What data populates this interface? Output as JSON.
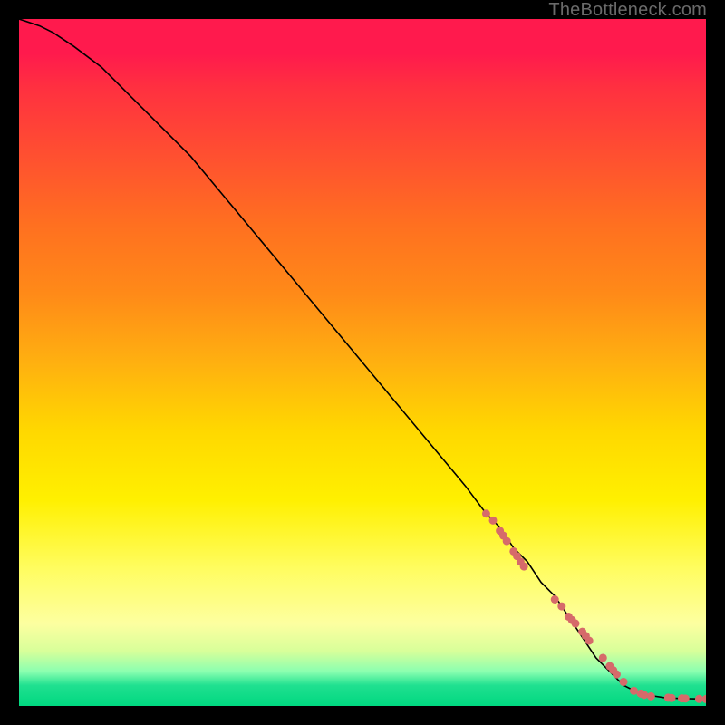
{
  "watermark": "TheBottleneck.com",
  "chart_data": {
    "type": "line",
    "title": "",
    "xlabel": "",
    "ylabel": "",
    "xlim": [
      0,
      100
    ],
    "ylim": [
      0,
      100
    ],
    "x": [
      0,
      3,
      5,
      8,
      12,
      16,
      20,
      25,
      30,
      35,
      40,
      45,
      50,
      55,
      60,
      65,
      68,
      70,
      72,
      74,
      76,
      78,
      80,
      82,
      84,
      86,
      88,
      90,
      92,
      94,
      96,
      98,
      100
    ],
    "y": [
      100,
      99,
      98,
      96,
      93,
      89,
      85,
      80,
      74,
      68,
      62,
      56,
      50,
      44,
      38,
      32,
      28,
      26,
      23,
      21,
      18,
      16,
      13,
      10,
      7,
      5,
      3,
      2,
      1.5,
      1.2,
      1.1,
      1.05,
      1
    ],
    "markers": {
      "x": [
        68,
        69,
        70,
        70.5,
        71,
        72,
        72.5,
        73,
        73.5,
        78,
        79,
        80,
        80.5,
        81,
        82,
        82.5,
        83,
        85,
        86,
        86.5,
        87,
        88,
        89.5,
        90.5,
        91,
        92,
        94.5,
        95,
        96.5,
        97,
        99,
        100
      ],
      "y": [
        28,
        27,
        25.5,
        24.8,
        24,
        22.5,
        21.8,
        21,
        20.3,
        15.5,
        14.5,
        13,
        12.5,
        12,
        10.8,
        10.2,
        9.5,
        7,
        5.8,
        5.2,
        4.6,
        3.5,
        2.2,
        1.8,
        1.6,
        1.4,
        1.2,
        1.15,
        1.1,
        1.08,
        1.02,
        1
      ],
      "color": "#d66a6a",
      "size": 9
    }
  },
  "colors": {
    "line": "#000000",
    "marker": "#d66a6a"
  }
}
